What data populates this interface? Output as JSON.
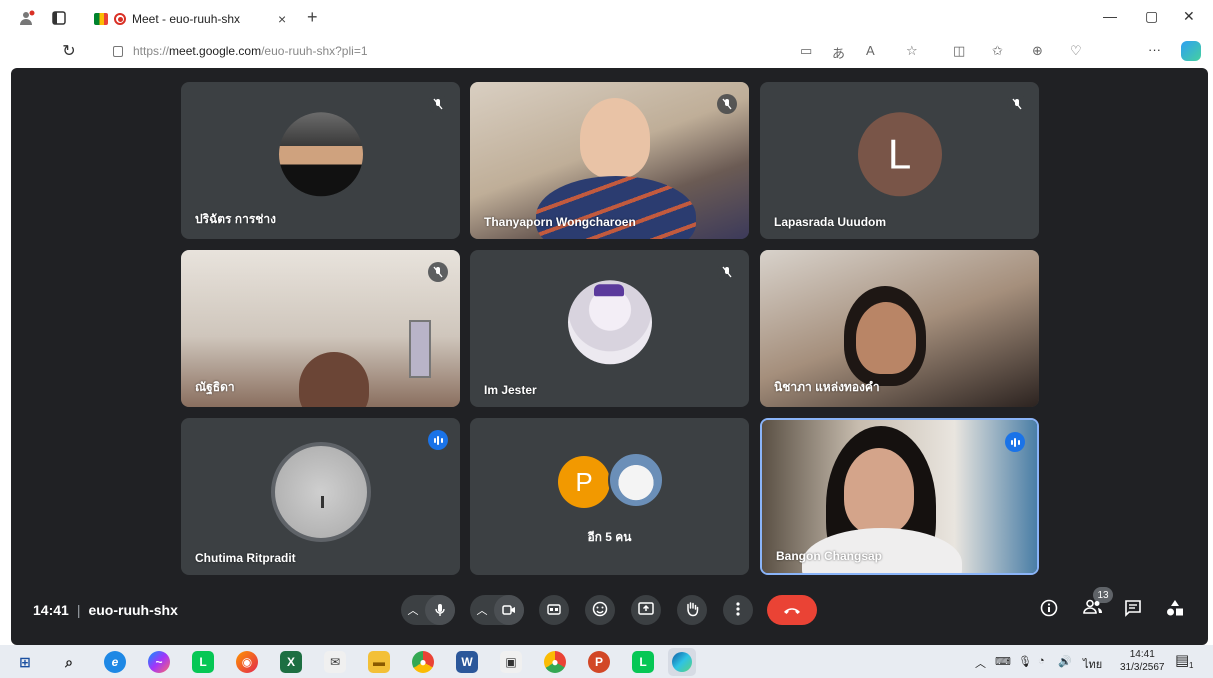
{
  "browser": {
    "tab_title": "Meet - euo-ruuh-shx",
    "tab_close": "×",
    "new_tab": "+",
    "url_prefix": "https://",
    "url_host": "meet.google.com",
    "url_path": "/euo-ruuh-shx?pli=1",
    "more_label": "···"
  },
  "tiles": [
    {
      "name": "ปริฉัตร การช่าง",
      "status": "muted"
    },
    {
      "name": "Thanyaporn Wongcharoen",
      "status": "muted"
    },
    {
      "name": "Lapasrada Uuudom",
      "status": "muted",
      "letter": "L"
    },
    {
      "name": "ณัฐธิดา",
      "status": "muted"
    },
    {
      "name": "Im Jester",
      "status": "muted"
    },
    {
      "name": "นิชาภา แหล่งทองคำ",
      "status": "none"
    },
    {
      "name": "Chutima Ritpradit",
      "status": "speaking"
    },
    {
      "name": "อีก 5 คน",
      "status": "none",
      "letter": "P"
    },
    {
      "name": "Bangon Changsap",
      "status": "speaking",
      "highlight_color": "#8ab4f8"
    }
  ],
  "controls": {
    "time": "14:41",
    "separator": "|",
    "meeting_code": "euo-ruuh-shx",
    "participant_count": "13",
    "end_call_color": "#ea4335"
  },
  "taskbar": {
    "language": "ไทย",
    "time": "14:41",
    "date": "31/3/2567",
    "notification_count": "1"
  },
  "colors": {
    "meet_bg": "#202124",
    "tile_bg": "#3c4043",
    "speaking_blue": "#1a73e8"
  }
}
